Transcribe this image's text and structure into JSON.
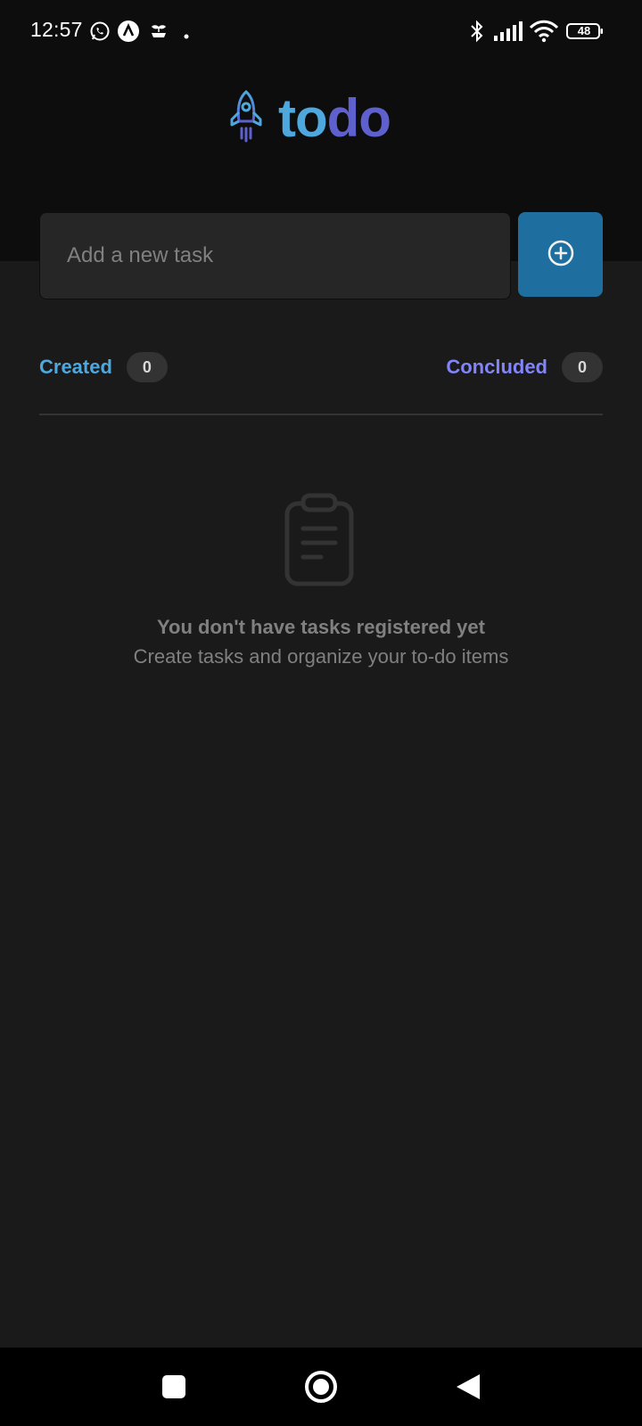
{
  "status_bar": {
    "time": "12:57",
    "battery": "48",
    "icons": [
      "whatsapp-icon",
      "a-app-icon",
      "plant-icon",
      "dot-icon",
      "bluetooth-icon",
      "signal-icon",
      "wifi-icon",
      "battery-icon"
    ]
  },
  "app": {
    "logo_part1": "to",
    "logo_part2": "do",
    "logo_icon": "rocket-icon"
  },
  "task_input": {
    "placeholder": "Add a new task",
    "value": ""
  },
  "add_button": {
    "icon": "plus-circle-icon"
  },
  "counters": {
    "created_label": "Created",
    "created_count": "0",
    "concluded_label": "Concluded",
    "concluded_count": "0"
  },
  "empty_state": {
    "icon": "clipboard-icon",
    "title": "You don't have tasks registered yet",
    "subtitle": "Create tasks and organize your to-do items"
  },
  "nav": {
    "icons": [
      "recents-icon",
      "home-icon",
      "back-icon"
    ]
  },
  "colors": {
    "header_bg": "#0d0d0d",
    "body_bg": "#1a1a1a",
    "blue": "#4ea8de",
    "purple": "#5e60ce",
    "purple_light": "#8284fa",
    "button_blue": "#1e6f9f"
  }
}
